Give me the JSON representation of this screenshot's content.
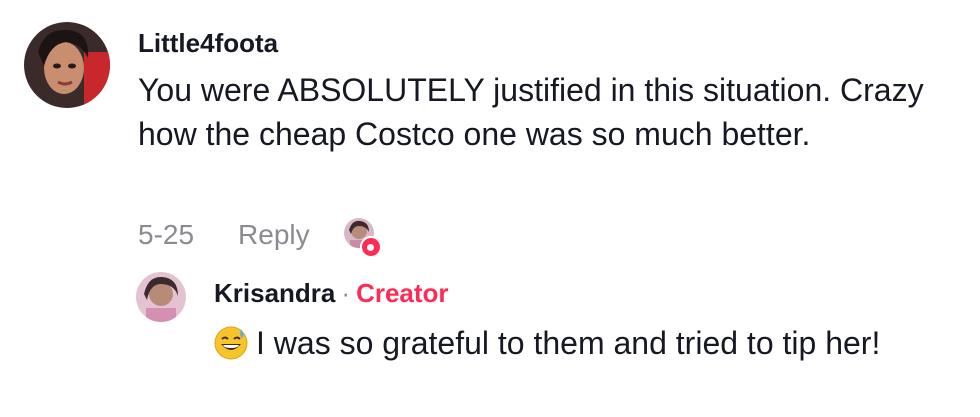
{
  "comment": {
    "username": "Little4foota",
    "text": "You were ABSOLUTELY justified in this situation. Crazy how the cheap Costco one was so much better.",
    "date": "5-25",
    "reply_label": "Reply",
    "avatar_icon": "user-avatar",
    "liked_by_creator_icon": "creator-liked-avatar"
  },
  "reply": {
    "username": "Krisandra",
    "separator": "·",
    "badge": "Creator",
    "emoji_icon": "grinning-sweat-emoji",
    "text": "I was so grateful to them and tried to tip her!",
    "avatar_icon": "creator-avatar"
  },
  "colors": {
    "creator_badge": "#fe2c55",
    "meta_text": "#8a8b91",
    "primary_text": "#161823"
  }
}
